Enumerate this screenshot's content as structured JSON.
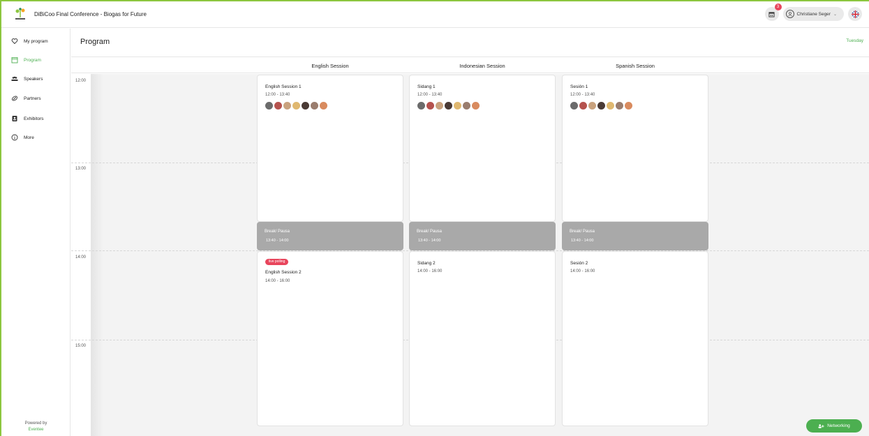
{
  "header": {
    "title": "DiBiCoo Final Conference - Biogas for Future",
    "notifications_count": "3",
    "user_name": "Christiane Seger"
  },
  "sidebar": {
    "items": [
      {
        "label": "My program",
        "icon": "heart-icon",
        "active": false
      },
      {
        "label": "Program",
        "icon": "calendar-icon",
        "active": true
      },
      {
        "label": "Speakers",
        "icon": "people-icon",
        "active": false
      },
      {
        "label": "Partners",
        "icon": "link-icon",
        "active": false
      },
      {
        "label": "Exhibitors",
        "icon": "badge-icon",
        "active": false
      },
      {
        "label": "More",
        "icon": "info-icon",
        "active": false
      }
    ],
    "powered_by": "Powered by",
    "brand": "Eventee"
  },
  "main": {
    "title": "Program",
    "day": "Tuesday",
    "hours": [
      "12:00",
      "13:00",
      "14:00",
      "15:00"
    ],
    "columns": [
      {
        "name": "English Session",
        "session1": {
          "title": "English Session 1",
          "time": "12:00 - 13:40"
        },
        "break": {
          "title": "Break/ Pausa",
          "time": "13:40 - 14:00"
        },
        "session2": {
          "title": "English Session 2",
          "time": "14:00 - 16:00",
          "tag": "live polling"
        }
      },
      {
        "name": "Indonesian Session",
        "session1": {
          "title": "Sidang 1",
          "time": "12:00 - 13:40"
        },
        "break": {
          "title": "Break/ Pausa",
          "time": "13:40 - 14:00"
        },
        "session2": {
          "title": "Sidang 2",
          "time": "14:00 - 16:00"
        }
      },
      {
        "name": "Spanish Session",
        "session1": {
          "title": "Sesión 1",
          "time": "12:00 - 13:40"
        },
        "break": {
          "title": "Break/ Pausa",
          "time": "13:40 - 14:00"
        },
        "session2": {
          "title": "Sesión 2",
          "time": "14:00 - 16:00"
        }
      }
    ]
  },
  "networking_label": "Networking",
  "colors": {
    "accent": "#4caf50",
    "frame": "#8cc63f",
    "badge": "#e8455c",
    "break": "#a9a9a9"
  }
}
